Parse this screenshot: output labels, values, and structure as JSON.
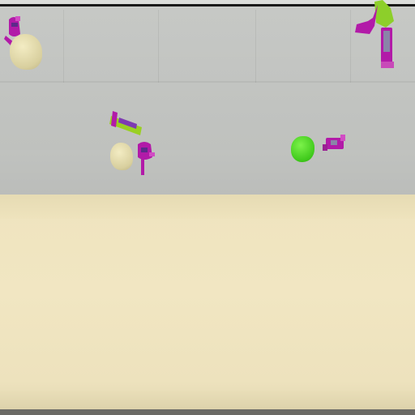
{
  "scene": {
    "colors": {
      "floor": "#c4c6c3",
      "table": "#efe4bf",
      "purple_toy": "#b21aa8",
      "green_toy": "#9ad022",
      "green_blob": "#3fc91b",
      "tan_bag": "#d8cf9e"
    },
    "objects": [
      "purple-toy-top-left",
      "tan-bag-top-left",
      "purple-green-toy-top-right",
      "green-purple-toy-center",
      "tan-bag-center",
      "purple-toy-center",
      "green-blob",
      "purple-toy-right"
    ]
  }
}
